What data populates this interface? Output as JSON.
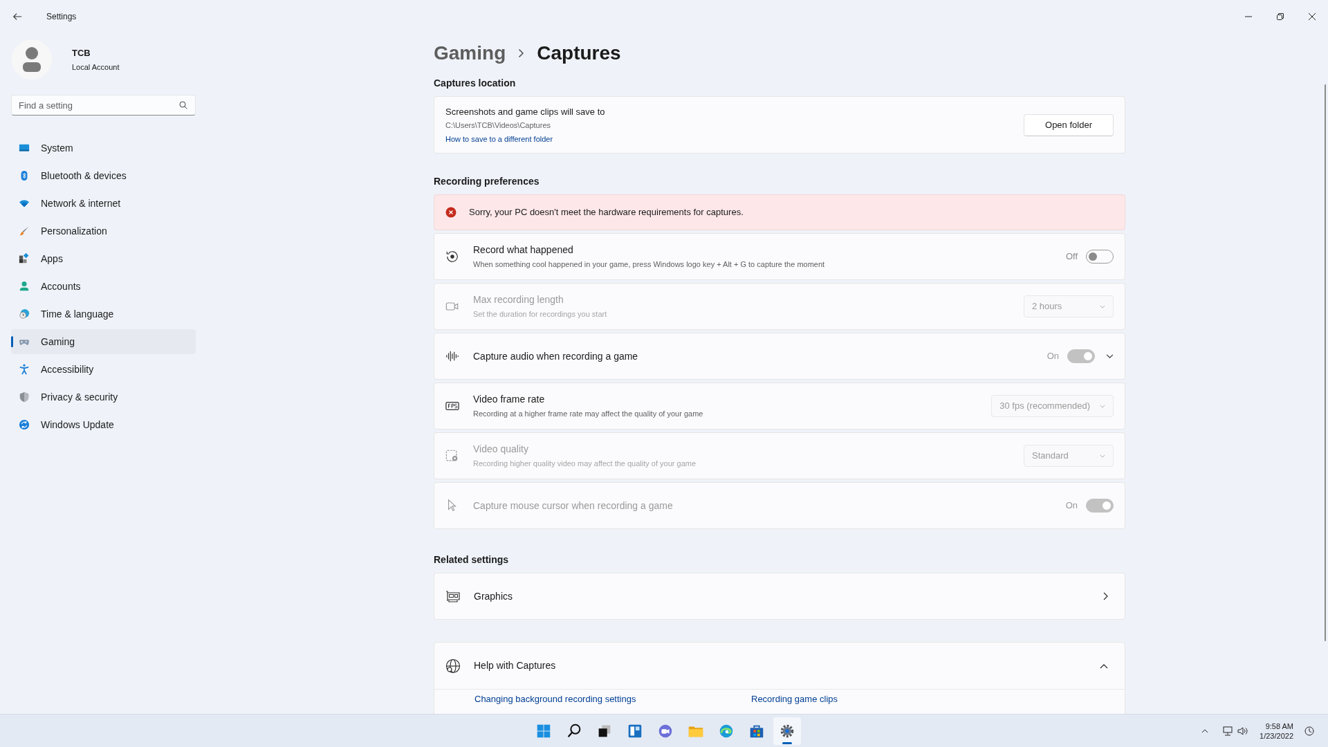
{
  "window": {
    "title": "Settings"
  },
  "user": {
    "name": "TCB",
    "account_type": "Local Account"
  },
  "search": {
    "placeholder": "Find a setting"
  },
  "nav": [
    {
      "label": "System",
      "selected": false
    },
    {
      "label": "Bluetooth & devices",
      "selected": false
    },
    {
      "label": "Network & internet",
      "selected": false
    },
    {
      "label": "Personalization",
      "selected": false
    },
    {
      "label": "Apps",
      "selected": false
    },
    {
      "label": "Accounts",
      "selected": false
    },
    {
      "label": "Time & language",
      "selected": false
    },
    {
      "label": "Gaming",
      "selected": true
    },
    {
      "label": "Accessibility",
      "selected": false
    },
    {
      "label": "Privacy & security",
      "selected": false
    },
    {
      "label": "Windows Update",
      "selected": false
    }
  ],
  "breadcrumb": {
    "parent": "Gaming",
    "current": "Captures"
  },
  "captures_location": {
    "heading": "Captures location",
    "title": "Screenshots and game clips will save to",
    "path": "C:\\Users\\TCB\\Videos\\Captures",
    "link": "How to save to a different folder",
    "button": "Open folder"
  },
  "recording_preferences": {
    "heading": "Recording preferences",
    "error": "Sorry, your PC doesn't meet the hardware requirements for captures.",
    "rows": [
      {
        "kind": "toggle",
        "title": "Record what happened",
        "description": "When something cool happened in your game, press Windows logo key + Alt + G to capture the moment",
        "disabled": false,
        "control": {
          "label": "Off",
          "on": false,
          "disabled": false
        }
      },
      {
        "kind": "dropdown",
        "title": "Max recording length",
        "description": "Set the duration for recordings you start",
        "disabled": true,
        "control": {
          "value": "2 hours",
          "disabled": true
        }
      },
      {
        "kind": "toggle_expand",
        "title": "Capture audio when recording a game",
        "disabled": false,
        "expanded": false,
        "control": {
          "label": "On",
          "on": true,
          "disabled": true
        }
      },
      {
        "kind": "dropdown",
        "title": "Video frame rate",
        "description": "Recording at a higher frame rate may affect the quality of your game",
        "disabled": false,
        "control": {
          "value": "30 fps (recommended)",
          "disabled": true
        }
      },
      {
        "kind": "dropdown",
        "title": "Video quality",
        "description": "Recording higher quality video may affect the quality of your game",
        "disabled": true,
        "control": {
          "value": "Standard",
          "disabled": true
        }
      },
      {
        "kind": "toggle",
        "title": "Capture mouse cursor when recording a game",
        "disabled": true,
        "control": {
          "label": "On",
          "on": true,
          "disabled": true
        }
      }
    ]
  },
  "related_settings": {
    "heading": "Related settings",
    "items": [
      {
        "label": "Graphics"
      }
    ]
  },
  "help": {
    "title": "Help with Captures",
    "expanded": true,
    "links": [
      "Changing background recording settings",
      "Recording game clips"
    ]
  },
  "taskbar": {
    "apps": [
      {
        "selected": false
      },
      {
        "selected": false
      },
      {
        "selected": false
      },
      {
        "selected": false
      },
      {
        "selected": false
      },
      {
        "selected": false
      },
      {
        "selected": false
      },
      {
        "selected": false
      },
      {
        "selected": true
      }
    ]
  },
  "clock": {
    "time": "9:58 AM",
    "date": "1/23/2022"
  }
}
